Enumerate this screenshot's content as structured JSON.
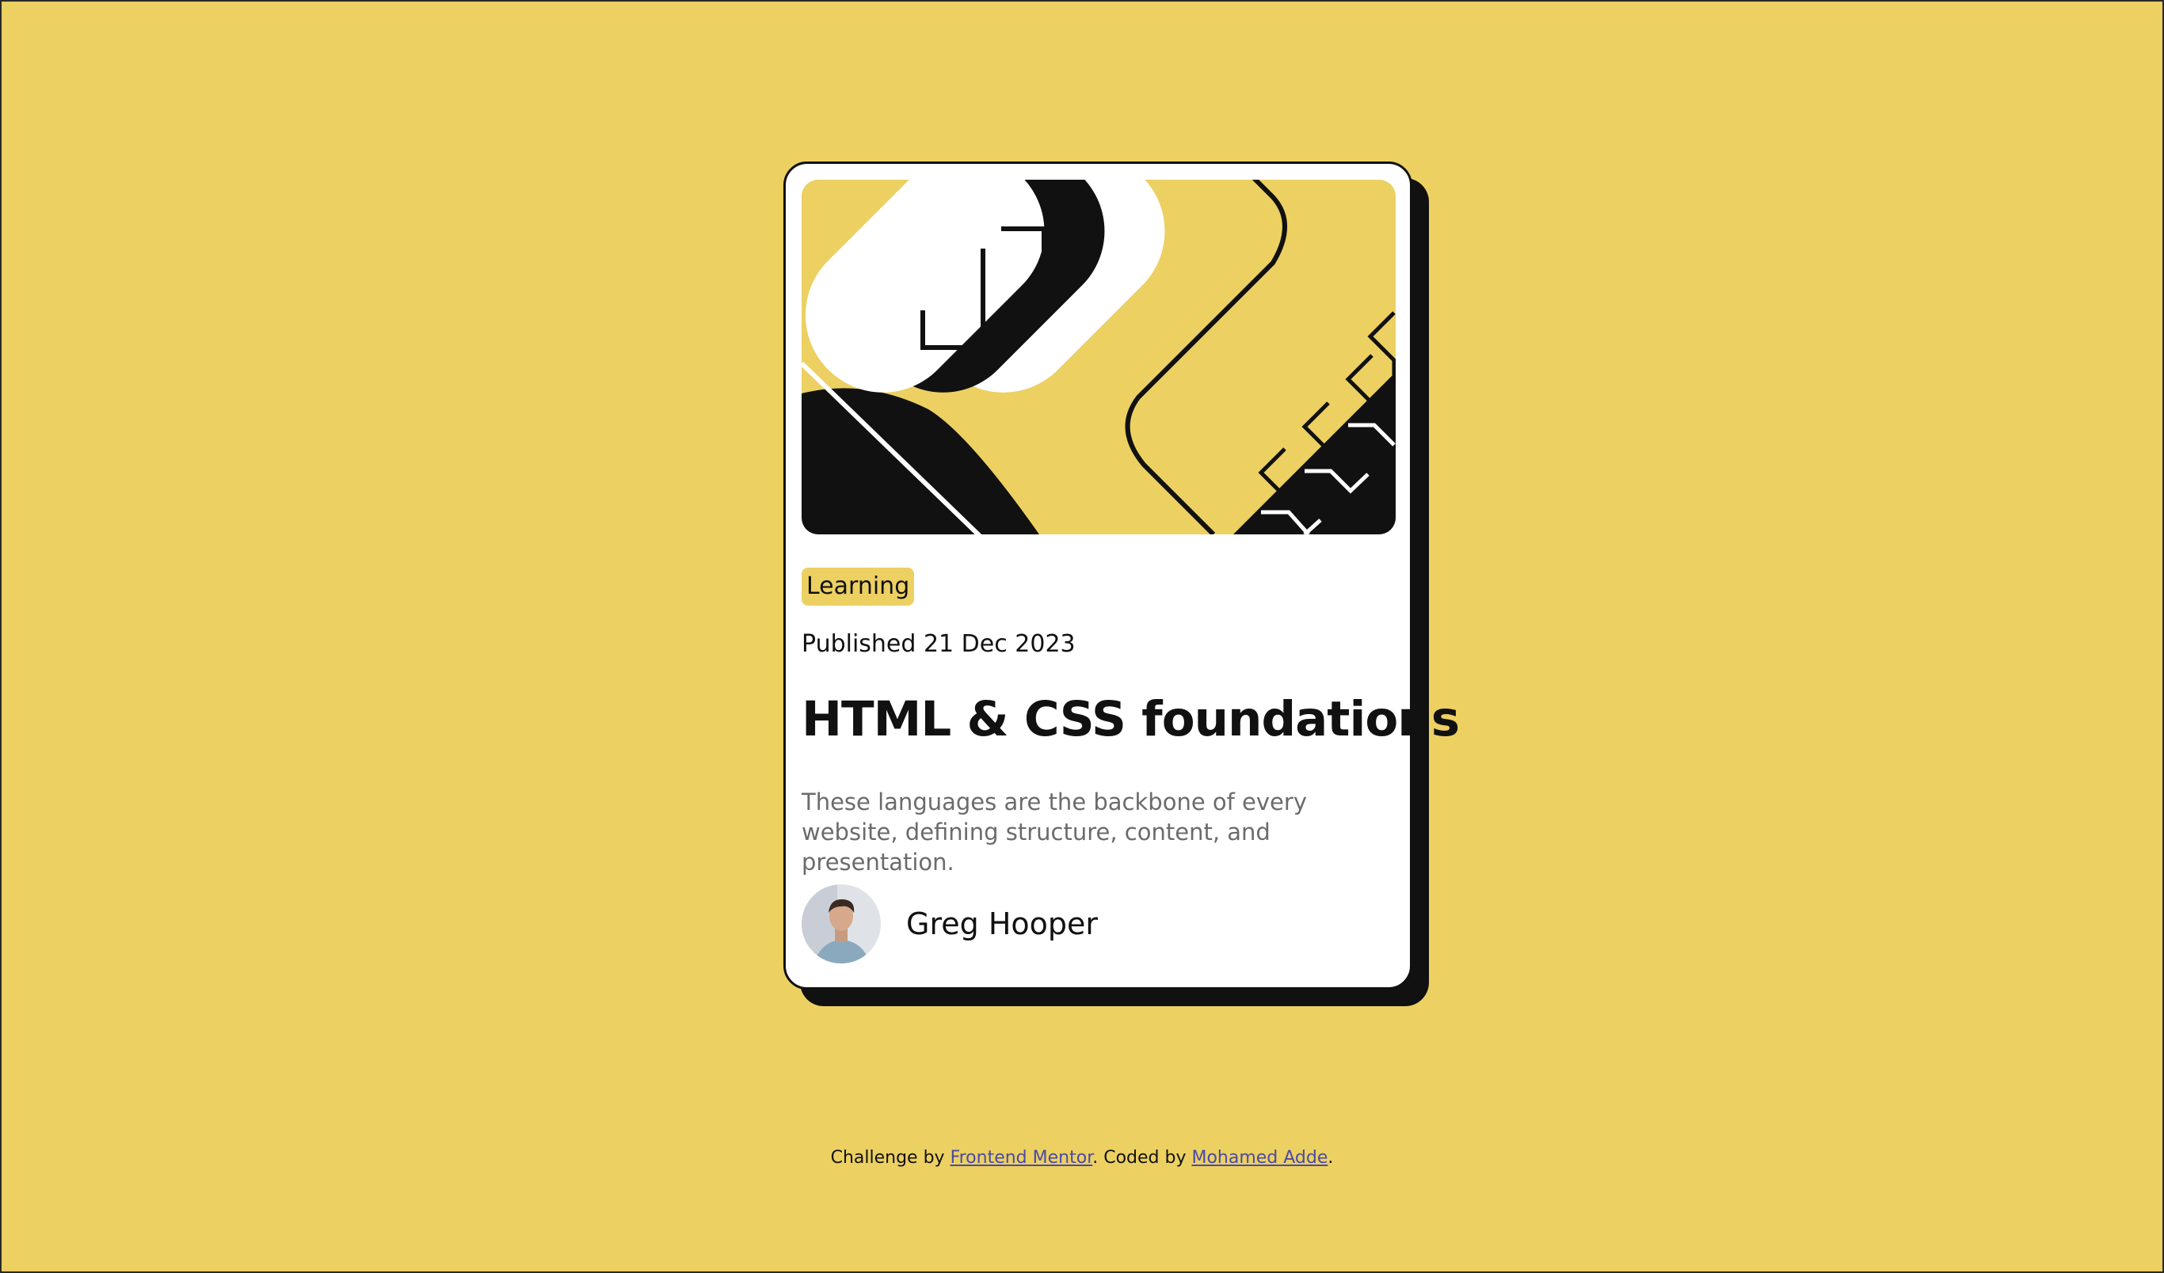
{
  "card": {
    "tag": "Learning",
    "published": "Published 21 Dec 2023",
    "title": "HTML & CSS foundations",
    "description": "These languages are the backbone of every website, defining structure, content, and presentation.",
    "author": {
      "name": "Greg Hooper"
    }
  },
  "footer": {
    "prefix": "Challenge by ",
    "link1": "Frontend Mentor",
    "middle": ". Coded by ",
    "link2": "Mohamed Adde",
    "suffix": "."
  },
  "colors": {
    "background": "#ecd062",
    "card": "#ffffff",
    "ink": "#111111",
    "muted": "#6b6b6b",
    "link": "#4a4aa8"
  }
}
